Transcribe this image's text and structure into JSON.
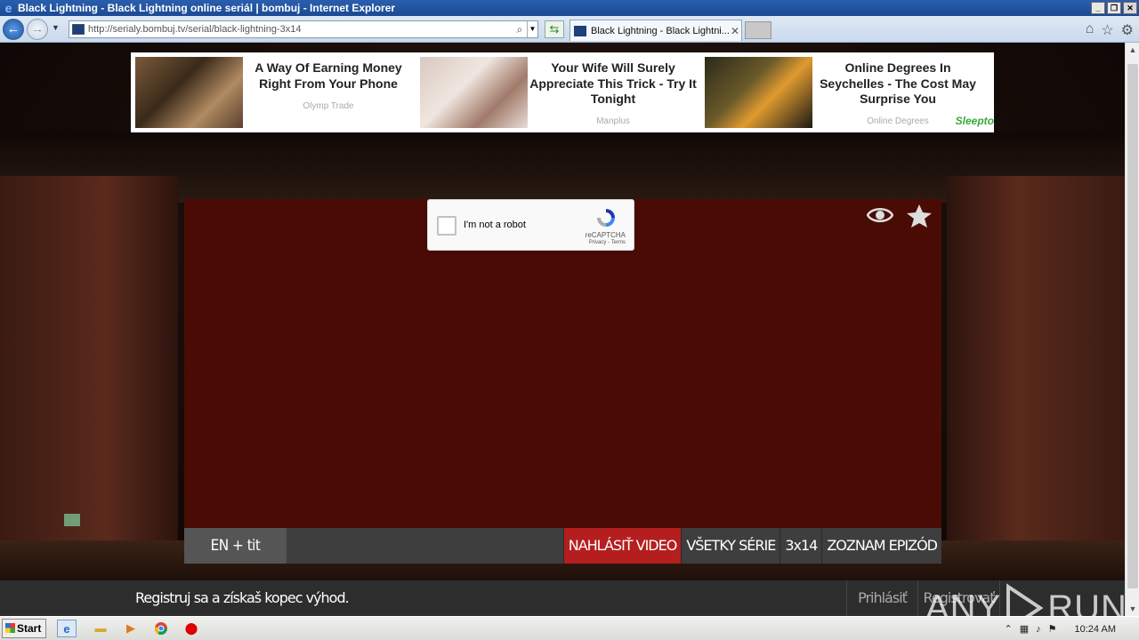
{
  "window": {
    "title": "Black Lightning - Black Lightning online seriál | bombuj - Internet Explorer",
    "controls": [
      "minimize",
      "restore",
      "close"
    ]
  },
  "browser": {
    "url": "http://serialy.bombuj.tv/serial/black-lightning-3x14",
    "tab_title": "Black Lightning - Black Lightni...",
    "icons": [
      "back-icon",
      "forward-icon",
      "search-icon",
      "refresh-icon",
      "home-icon",
      "favorites-icon",
      "settings-icon"
    ]
  },
  "ads": [
    {
      "title": "A Way Of Earning Money Right From Your Phone",
      "source": "Olymp Trade"
    },
    {
      "title": "Your Wife Will Surely Appreciate This Trick - Try It Tonight",
      "source": "Manplus"
    },
    {
      "title": "Online Degrees In Seychelles - The Cost May Surprise You",
      "source": "Online Degrees"
    }
  ],
  "sponsor_logo_text": "Sleepto",
  "captcha": {
    "label": "I'm not a robot",
    "brand": "reCAPTCHA",
    "terms": "Privacy - Terms"
  },
  "player": {
    "icons": [
      "eye-icon",
      "star-icon"
    ],
    "language": "EN + tit",
    "buttons": {
      "report": "NAHLÁSIŤ VIDEO",
      "all_series": "VŠETKY SÉRIE",
      "episode": "3x14",
      "episode_list": "ZOZNAM EPIZÓD"
    }
  },
  "bottom_bar": {
    "promo": "Registruj sa a získaš kopec výhod.",
    "login": "Prihlásiť",
    "register": "Registrovať"
  },
  "watermark": {
    "left": "ANY",
    "right": "RUN"
  },
  "taskbar": {
    "start_label": "Start",
    "clock": "10:24 AM"
  },
  "colors": {
    "player_bg": "#4a0b04",
    "report_btn": "#b51e1e",
    "control_bar": "#3e3e3e",
    "bottom_bar": "#2d2d2d"
  }
}
